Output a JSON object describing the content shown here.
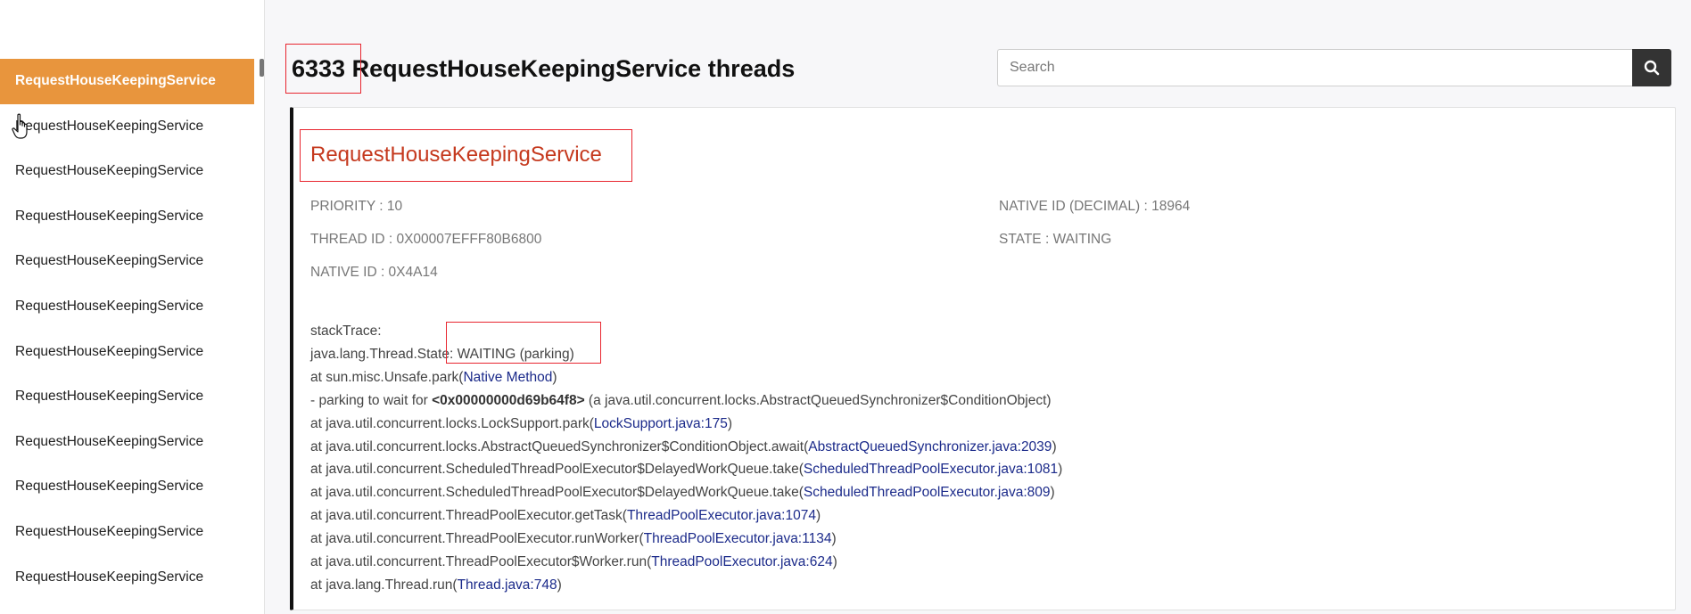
{
  "sidebar": {
    "items": [
      {
        "label": "RequestHouseKeepingService",
        "active": true
      },
      {
        "label": "RequestHouseKeepingService"
      },
      {
        "label": "RequestHouseKeepingService"
      },
      {
        "label": "RequestHouseKeepingService"
      },
      {
        "label": "RequestHouseKeepingService"
      },
      {
        "label": "RequestHouseKeepingService"
      },
      {
        "label": "RequestHouseKeepingService"
      },
      {
        "label": "RequestHouseKeepingService"
      },
      {
        "label": "RequestHouseKeepingService"
      },
      {
        "label": "RequestHouseKeepingService"
      },
      {
        "label": "RequestHouseKeepingService"
      },
      {
        "label": "RequestHouseKeepingService"
      }
    ]
  },
  "header": {
    "title": "6333 RequestHouseKeepingService threads"
  },
  "search": {
    "placeholder": "Search",
    "value": "",
    "icon": "search-icon"
  },
  "thread": {
    "name": "RequestHouseKeepingService",
    "priority": "PRIORITY : 10",
    "thread_id": "THREAD ID : 0X00007EFFF80B6800",
    "native_id": "NATIVE ID : 0X4A14",
    "native_id_decimal": "NATIVE ID (DECIMAL) : 18964",
    "state": "STATE : WAITING"
  },
  "stack": {
    "label": "stackTrace:",
    "state_line": "java.lang.Thread.State: WAITING (parking)",
    "lines": [
      {
        "pre": "at sun.misc.Unsafe.park(",
        "link": "Native Method",
        "post": ")"
      },
      {
        "pre": "- parking to wait for  ",
        "bold": "<0x00000000d69b64f8>",
        "post": " (a java.util.concurrent.locks.AbstractQueuedSynchronizer$ConditionObject)"
      },
      {
        "pre": "at java.util.concurrent.locks.LockSupport.park(",
        "link": "LockSupport.java:175",
        "post": ")"
      },
      {
        "pre": "at java.util.concurrent.locks.AbstractQueuedSynchronizer$ConditionObject.await(",
        "link": "AbstractQueuedSynchronizer.java:2039",
        "post": ")"
      },
      {
        "pre": "at java.util.concurrent.ScheduledThreadPoolExecutor$DelayedWorkQueue.take(",
        "link": "ScheduledThreadPoolExecutor.java:1081",
        "post": ")"
      },
      {
        "pre": "at java.util.concurrent.ScheduledThreadPoolExecutor$DelayedWorkQueue.take(",
        "link": "ScheduledThreadPoolExecutor.java:809",
        "post": ")"
      },
      {
        "pre": "at java.util.concurrent.ThreadPoolExecutor.getTask(",
        "link": "ThreadPoolExecutor.java:1074",
        "post": ")"
      },
      {
        "pre": "at java.util.concurrent.ThreadPoolExecutor.runWorker(",
        "link": "ThreadPoolExecutor.java:1134",
        "post": ")"
      },
      {
        "pre": "at java.util.concurrent.ThreadPoolExecutor$Worker.run(",
        "link": "ThreadPoolExecutor.java:624",
        "post": ")"
      },
      {
        "pre": "at java.lang.Thread.run(",
        "link": "Thread.java:748",
        "post": ")"
      }
    ]
  },
  "colors": {
    "accent": "#e8953d",
    "thread_name": "#c5391e",
    "link": "#1b2a8a",
    "highlight": "#e8262f"
  }
}
